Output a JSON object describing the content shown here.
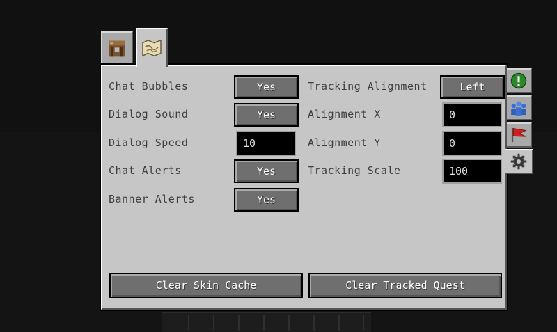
{
  "tabs": [
    {
      "icon": "crafting-table-icon"
    },
    {
      "icon": "map-icon"
    }
  ],
  "side_tabs": [
    {
      "icon": "exclamation-icon"
    },
    {
      "icon": "party-icon"
    },
    {
      "icon": "red-flag-icon"
    },
    {
      "icon": "gear-icon"
    }
  ],
  "settings": {
    "chat_bubbles": {
      "label": "Chat Bubbles",
      "value": "Yes"
    },
    "dialog_sound": {
      "label": "Dialog Sound",
      "value": "Yes"
    },
    "dialog_speed": {
      "label": "Dialog Speed",
      "value": "10"
    },
    "chat_alerts": {
      "label": "Chat Alerts",
      "value": "Yes"
    },
    "banner_alerts": {
      "label": "Banner Alerts",
      "value": "Yes"
    },
    "tracking_alignment": {
      "label": "Tracking Alignment",
      "value": "Left"
    },
    "alignment_x": {
      "label": "Alignment X",
      "value": "0"
    },
    "alignment_y": {
      "label": "Alignment Y",
      "value": "0"
    },
    "tracking_scale": {
      "label": "Tracking Scale",
      "value": "100"
    }
  },
  "actions": {
    "clear_skin_cache": "Clear Skin Cache",
    "clear_tracked_quest": "Clear Tracked Quest"
  },
  "colors": {
    "panel": "#c6c6c6",
    "button": "#6f6f6f",
    "field": "#000000",
    "label": "#3f3f3f"
  }
}
